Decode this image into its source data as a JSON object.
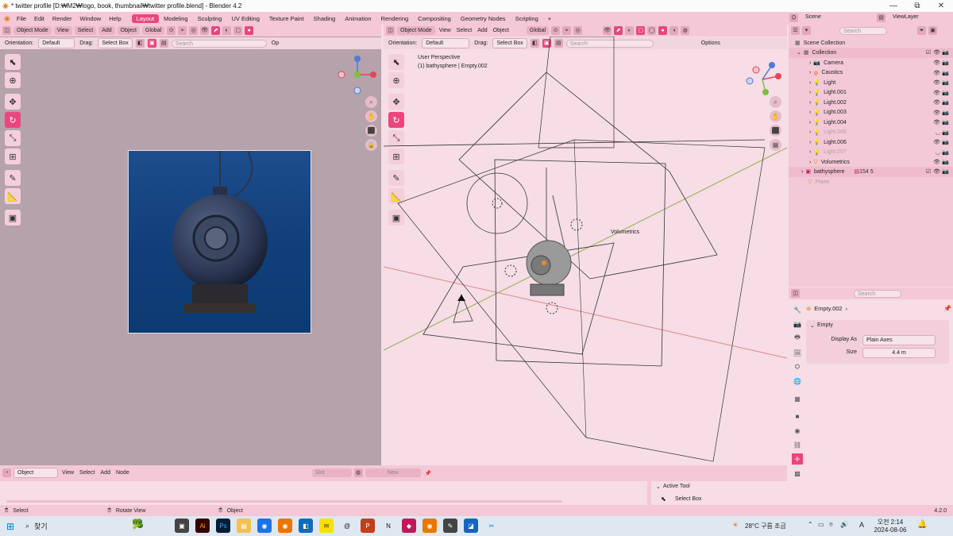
{
  "window": {
    "title": "* twitter profile [D:₩M2₩logo, book, thumbnail₩twitter profile.blend] - Blender 4.2",
    "min": "—",
    "max": "⧉",
    "close": "✕"
  },
  "menu": [
    "File",
    "Edit",
    "Render",
    "Window",
    "Help"
  ],
  "workspaces": [
    {
      "label": "Layout",
      "active": true
    },
    {
      "label": "Modeling"
    },
    {
      "label": "Sculpting"
    },
    {
      "label": "UV Editing"
    },
    {
      "label": "Texture Paint"
    },
    {
      "label": "Shading"
    },
    {
      "label": "Animation"
    },
    {
      "label": "Rendering"
    },
    {
      "label": "Compositing"
    },
    {
      "label": "Geometry Nodes"
    },
    {
      "label": "Scripting"
    }
  ],
  "workspace_add": "+",
  "scene": {
    "label": "Scene",
    "viewlayer": "ViewLayer"
  },
  "left_viewport": {
    "mode": "Object Mode",
    "menus": [
      "View",
      "Select",
      "Add",
      "Object"
    ],
    "transform": "Global",
    "orientation_label": "Orientation:",
    "orientation": "Default",
    "drag_label": "Drag:",
    "drag": "Select Box",
    "search_placeholder": "Search",
    "op_label": "Op"
  },
  "right_viewport": {
    "mode": "Object Mode",
    "menus": [
      "View",
      "Select",
      "Add",
      "Object"
    ],
    "transform": "Global",
    "orientation_label": "Orientation:",
    "orientation": "Default",
    "drag_label": "Drag:",
    "drag": "Select Box",
    "search_placeholder": "Search",
    "options": "Options",
    "overlay_line1": "User Perspective",
    "overlay_line2": "(1) bathysphere | Empty.002",
    "label_volumetrics": "Volumetrics"
  },
  "outliner": {
    "search_placeholder": "Search",
    "root": "Scene Collection",
    "collection": "Collection",
    "items": [
      {
        "name": "Camera",
        "dim": false
      },
      {
        "name": "Caustics",
        "dim": false
      },
      {
        "name": "Light",
        "dim": false
      },
      {
        "name": "Light.001",
        "dim": false
      },
      {
        "name": "Light.002",
        "dim": false
      },
      {
        "name": "Light.003",
        "dim": false
      },
      {
        "name": "Light.004",
        "dim": false
      },
      {
        "name": "Light.005",
        "dim": true
      },
      {
        "name": "Light.006",
        "dim": false
      },
      {
        "name": "Light.007",
        "dim": true
      },
      {
        "name": "Volumetrics",
        "dim": false
      }
    ],
    "bathysphere": "bathysphere",
    "bathysphere_badge1": "154",
    "bathysphere_badge2": "5",
    "plane": "Plane"
  },
  "properties": {
    "search_placeholder": "Search",
    "object_name": "Empty.002",
    "panel": "Empty",
    "display_as_label": "Display As",
    "display_as": "Plain Axes",
    "size_label": "Size",
    "size": "4.4 m"
  },
  "node_editor": {
    "mode": "Object",
    "menus": [
      "View",
      "Select",
      "Add",
      "Node"
    ],
    "slot": "Slot",
    "new": "New"
  },
  "active_tool": {
    "header": "Active Tool",
    "tool": "Select Box"
  },
  "status": {
    "select": "Select",
    "rotate": "Rotate View",
    "object": "Object",
    "version": "4.2.0"
  },
  "taskbar": {
    "search": "찾기",
    "weather": "28°C  구름 조금",
    "ime": "A",
    "time": "오전 2:14",
    "date": "2024-08-06"
  },
  "colors": {
    "accent": "#e8477e",
    "header": "#f4c8d6",
    "viewport_right": "#f6dde6",
    "viewport_left": "#b5a2aa",
    "ocean": "#0f3f78"
  }
}
